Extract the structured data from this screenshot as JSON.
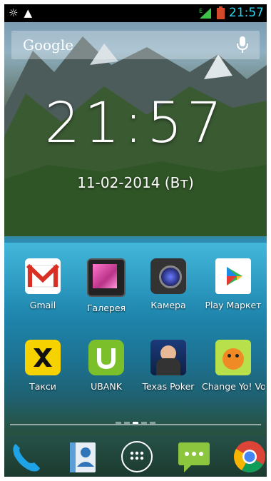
{
  "status_bar": {
    "time": "21:57",
    "left_icons": [
      "brightness-icon",
      "warning-icon"
    ],
    "right_icons": [
      "signal-icon",
      "battery-icon"
    ],
    "network_letter": "E"
  },
  "search": {
    "brand": "Google",
    "icon": "microphone-icon"
  },
  "clock": {
    "time": "21:57",
    "date": "11-02-2014  (Вт)"
  },
  "apps": [
    {
      "label": "Gmail",
      "icon": "gmail-icon"
    },
    {
      "label": "Галерея",
      "icon": "gallery-icon"
    },
    {
      "label": "Камера",
      "icon": "camera-icon"
    },
    {
      "label": "Play Маркет",
      "icon": "play-store-icon"
    },
    {
      "label": "Такси",
      "icon": "taxi-icon"
    },
    {
      "label": "UBANK",
      "icon": "ubank-icon"
    },
    {
      "label": "Texas Poker",
      "icon": "texas-poker-icon"
    },
    {
      "label": "Change Yo! Vo",
      "icon": "change-yo-icon"
    }
  ],
  "page_indicator": {
    "pages": 5,
    "active_index": 2
  },
  "dock": [
    {
      "icon": "phone-icon"
    },
    {
      "icon": "contacts-icon"
    },
    {
      "icon": "app-drawer-icon"
    },
    {
      "icon": "messaging-icon"
    },
    {
      "icon": "chrome-icon"
    }
  ]
}
